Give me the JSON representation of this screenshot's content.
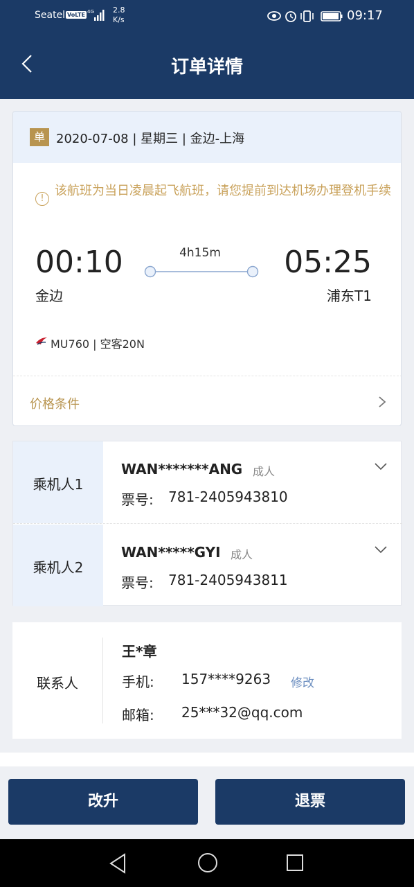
{
  "status_bar": {
    "carrier": "Seatel",
    "volte": "VoLTE",
    "network": "4G",
    "speed_value": "2.8",
    "speed_unit": "K/s",
    "time": "09:17"
  },
  "nav": {
    "title": "订单详情",
    "back_icon": "chevron-left-icon"
  },
  "flight": {
    "badge": "单",
    "summary": "2020-07-08 | 星期三 | 金边-上海",
    "warning": "该航班为当日凌晨起飞航班，请您提前到达机场办理登机手续",
    "departure_time": "00:10",
    "departure_airport": "金边",
    "arrival_time": "05:25",
    "arrival_airport": "浦东T1",
    "duration": "4h15m",
    "flight_info": "MU760 | 空客20N",
    "price_conditions": "价格条件"
  },
  "passengers": [
    {
      "label": "乘机人1",
      "name": "WAN*******ANG",
      "type": "成人",
      "ticket_label": "票号:",
      "ticket_no": "781-2405943810"
    },
    {
      "label": "乘机人2",
      "name": "WAN*****GYI",
      "type": "成人",
      "ticket_label": "票号:",
      "ticket_no": "781-2405943811"
    }
  ],
  "contact": {
    "label": "联系人",
    "name": "王*章",
    "phone_label": "手机:",
    "phone": "157****9263",
    "modify": "修改",
    "email_label": "邮箱:",
    "email": "25***32@qq.com"
  },
  "actions": {
    "upgrade": "改升",
    "refund": "退票"
  },
  "colors": {
    "primary": "#1b3a66",
    "gold": "#b8944f",
    "warning": "#c9a25b",
    "header_bg": "#eaf1fb",
    "link": "#6d8fc0"
  }
}
